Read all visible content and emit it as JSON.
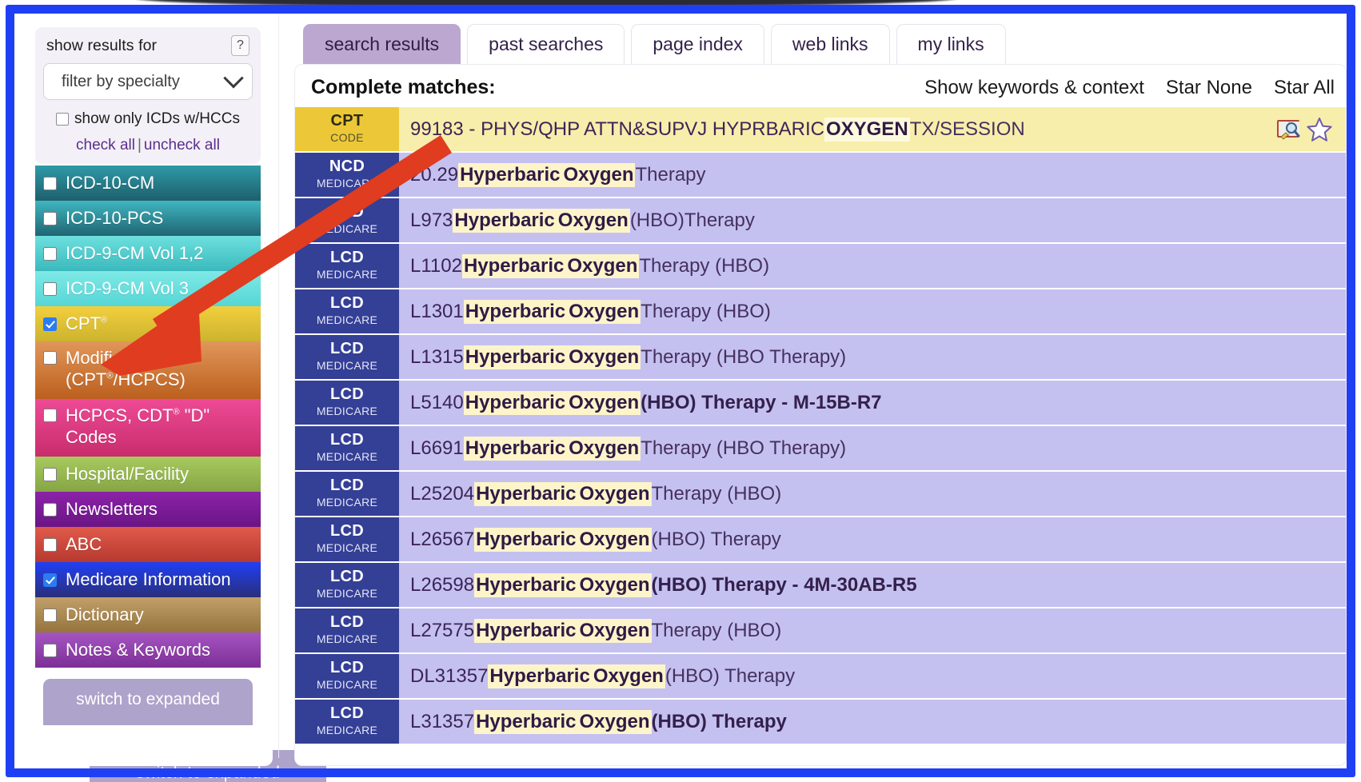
{
  "sidebar": {
    "filter_label": "show results for",
    "help_label": "?",
    "specialty_value": "filter by specialty",
    "hcc_label": "show only ICDs w/HCCs",
    "check_all": "check all",
    "check_sep": "|",
    "uncheck_all": "uncheck all",
    "expand_label": "switch to expanded",
    "categories": [
      {
        "label": "ICD-10-CM",
        "checked": false,
        "color_from": "#2f9aa8",
        "color_to": "#1d5f6b",
        "twoline": false
      },
      {
        "label": "ICD-10-PCS",
        "checked": false,
        "color_from": "#3fb6c0",
        "color_to": "#1f6572",
        "twoline": false
      },
      {
        "label": "ICD-9-CM Vol 1,2",
        "checked": false,
        "color_from": "#6ee0de",
        "color_to": "#3ab9bd",
        "twoline": false
      },
      {
        "label": "ICD-9-CM Vol 3",
        "checked": false,
        "color_from": "#7ee9e6",
        "color_to": "#56d6d6",
        "twoline": false
      },
      {
        "label": "CPT®",
        "checked": true,
        "color_from": "#f2cf3e",
        "color_to": "#cdb32e",
        "twoline": false
      },
      {
        "label": "Modifiers (CPT®/HCPCS)",
        "checked": false,
        "color_from": "#e0975a",
        "color_to": "#bc5f1e",
        "twoline": true
      },
      {
        "label": "HCPCS, CDT® \"D\" Codes",
        "checked": false,
        "color_from": "#ee4a96",
        "color_to": "#c82d6c",
        "twoline": true
      },
      {
        "label": "Hospital/Facility",
        "checked": false,
        "color_from": "#a8ca5e",
        "color_to": "#86a545",
        "twoline": false
      },
      {
        "label": "Newsletters",
        "checked": false,
        "color_from": "#8b22a8",
        "color_to": "#6b1585",
        "twoline": false
      },
      {
        "label": "ABC",
        "checked": false,
        "color_from": "#e05a4a",
        "color_to": "#b6392f",
        "twoline": false
      },
      {
        "label": "Medicare Information",
        "checked": true,
        "color_from": "#1f3ff5",
        "color_to": "#2a2f7a",
        "twoline": false
      },
      {
        "label": "Dictionary",
        "checked": false,
        "color_from": "#c2a06a",
        "color_to": "#96743c",
        "twoline": false
      },
      {
        "label": "Notes & Keywords",
        "checked": false,
        "color_from": "#a455c2",
        "color_to": "#7e2f96",
        "twoline": false
      }
    ]
  },
  "tabs": [
    {
      "label": "search results",
      "active": true
    },
    {
      "label": "past searches",
      "active": false
    },
    {
      "label": "page index",
      "active": false
    },
    {
      "label": "web links",
      "active": false
    },
    {
      "label": "my links",
      "active": false
    }
  ],
  "results": {
    "heading": "Complete matches:",
    "actions": [
      "Show keywords & context",
      "Star None",
      "Star All"
    ],
    "rows": [
      {
        "tag": "CPT",
        "sub": "CODE",
        "kind": "cpt",
        "code": "99183 - PHYS/QHP ATTN&SUPVJ HYPRBARIC ",
        "hl1": "OXYGEN",
        "mid": "",
        "hl2": "",
        "tail": " TX/SESSION",
        "bold_tail": false,
        "icons": true
      },
      {
        "tag": "NCD",
        "sub": "MEDICARE",
        "kind": "med",
        "code": "20.29 ",
        "hl1": "Hyperbaric",
        "mid": " ",
        "hl2": "Oxygen",
        "tail": " Therapy",
        "bold_tail": false,
        "icons": false
      },
      {
        "tag": "LCD",
        "sub": "MEDICARE",
        "kind": "med",
        "code": "L973 ",
        "hl1": "Hyperbaric",
        "mid": " ",
        "hl2": "Oxygen",
        "tail": " (HBO)Therapy",
        "bold_tail": false,
        "icons": false
      },
      {
        "tag": "LCD",
        "sub": "MEDICARE",
        "kind": "med",
        "code": "L1102 ",
        "hl1": "Hyperbaric",
        "mid": " ",
        "hl2": "Oxygen",
        "tail": " Therapy (HBO)",
        "bold_tail": false,
        "icons": false
      },
      {
        "tag": "LCD",
        "sub": "MEDICARE",
        "kind": "med",
        "code": "L1301 ",
        "hl1": "Hyperbaric",
        "mid": " ",
        "hl2": "Oxygen",
        "tail": " Therapy (HBO)",
        "bold_tail": false,
        "icons": false
      },
      {
        "tag": "LCD",
        "sub": "MEDICARE",
        "kind": "med",
        "code": "L1315 ",
        "hl1": "Hyperbaric",
        "mid": " ",
        "hl2": "Oxygen",
        "tail": " Therapy (HBO Therapy)",
        "bold_tail": false,
        "icons": false
      },
      {
        "tag": "LCD",
        "sub": "MEDICARE",
        "kind": "med",
        "code": "L5140 ",
        "hl1": "Hyperbaric",
        "mid": " ",
        "hl2": "Oxygen",
        "tail": " (HBO) Therapy - M-15B-R7",
        "bold_tail": true,
        "icons": false
      },
      {
        "tag": "LCD",
        "sub": "MEDICARE",
        "kind": "med",
        "code": "L6691 ",
        "hl1": "Hyperbaric",
        "mid": " ",
        "hl2": "Oxygen",
        "tail": " Therapy (HBO Therapy)",
        "bold_tail": false,
        "icons": false
      },
      {
        "tag": "LCD",
        "sub": "MEDICARE",
        "kind": "med",
        "code": "L25204 ",
        "hl1": "Hyperbaric",
        "mid": " ",
        "hl2": "Oxygen",
        "tail": " Therapy (HBO)",
        "bold_tail": false,
        "icons": false
      },
      {
        "tag": "LCD",
        "sub": "MEDICARE",
        "kind": "med",
        "code": "L26567 ",
        "hl1": "Hyperbaric",
        "mid": " ",
        "hl2": "Oxygen",
        "tail": " (HBO) Therapy",
        "bold_tail": false,
        "icons": false
      },
      {
        "tag": "LCD",
        "sub": "MEDICARE",
        "kind": "med",
        "code": "L26598 ",
        "hl1": "Hyperbaric",
        "mid": " ",
        "hl2": "Oxygen",
        "tail": " (HBO) Therapy - 4M-30AB-R5",
        "bold_tail": true,
        "icons": false
      },
      {
        "tag": "LCD",
        "sub": "MEDICARE",
        "kind": "med",
        "code": "L27575 ",
        "hl1": "Hyperbaric",
        "mid": " ",
        "hl2": "Oxygen",
        "tail": " Therapy (HBO)",
        "bold_tail": false,
        "icons": false
      },
      {
        "tag": "LCD",
        "sub": "MEDICARE",
        "kind": "med",
        "code": "DL31357 ",
        "hl1": "Hyperbaric",
        "mid": " ",
        "hl2": "Oxygen",
        "tail": " (HBO) Therapy",
        "bold_tail": false,
        "icons": false
      },
      {
        "tag": "LCD",
        "sub": "MEDICARE",
        "kind": "med",
        "code": "L31357 ",
        "hl1": "Hyperbaric",
        "mid": " ",
        "hl2": "Oxygen",
        "tail": " (HBO) Therapy",
        "bold_tail": true,
        "icons": false
      }
    ]
  },
  "annotation": {
    "arrow_color": "#e03c20",
    "highlight_frame_color": "#1f3ff5"
  },
  "icons": {
    "book_search": "book-search-icon",
    "star": "star-outline-icon"
  }
}
